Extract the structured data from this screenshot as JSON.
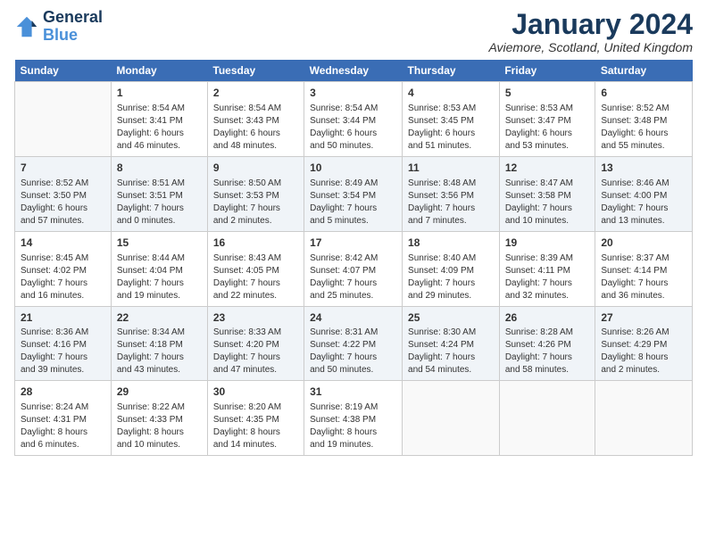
{
  "logo": {
    "line1": "General",
    "line2": "Blue"
  },
  "title": "January 2024",
  "location": "Aviemore, Scotland, United Kingdom",
  "weekdays": [
    "Sunday",
    "Monday",
    "Tuesday",
    "Wednesday",
    "Thursday",
    "Friday",
    "Saturday"
  ],
  "weeks": [
    [
      {
        "day": "",
        "info": ""
      },
      {
        "day": "1",
        "info": "Sunrise: 8:54 AM\nSunset: 3:41 PM\nDaylight: 6 hours\nand 46 minutes."
      },
      {
        "day": "2",
        "info": "Sunrise: 8:54 AM\nSunset: 3:43 PM\nDaylight: 6 hours\nand 48 minutes."
      },
      {
        "day": "3",
        "info": "Sunrise: 8:54 AM\nSunset: 3:44 PM\nDaylight: 6 hours\nand 50 minutes."
      },
      {
        "day": "4",
        "info": "Sunrise: 8:53 AM\nSunset: 3:45 PM\nDaylight: 6 hours\nand 51 minutes."
      },
      {
        "day": "5",
        "info": "Sunrise: 8:53 AM\nSunset: 3:47 PM\nDaylight: 6 hours\nand 53 minutes."
      },
      {
        "day": "6",
        "info": "Sunrise: 8:52 AM\nSunset: 3:48 PM\nDaylight: 6 hours\nand 55 minutes."
      }
    ],
    [
      {
        "day": "7",
        "info": "Sunrise: 8:52 AM\nSunset: 3:50 PM\nDaylight: 6 hours\nand 57 minutes."
      },
      {
        "day": "8",
        "info": "Sunrise: 8:51 AM\nSunset: 3:51 PM\nDaylight: 7 hours\nand 0 minutes."
      },
      {
        "day": "9",
        "info": "Sunrise: 8:50 AM\nSunset: 3:53 PM\nDaylight: 7 hours\nand 2 minutes."
      },
      {
        "day": "10",
        "info": "Sunrise: 8:49 AM\nSunset: 3:54 PM\nDaylight: 7 hours\nand 5 minutes."
      },
      {
        "day": "11",
        "info": "Sunrise: 8:48 AM\nSunset: 3:56 PM\nDaylight: 7 hours\nand 7 minutes."
      },
      {
        "day": "12",
        "info": "Sunrise: 8:47 AM\nSunset: 3:58 PM\nDaylight: 7 hours\nand 10 minutes."
      },
      {
        "day": "13",
        "info": "Sunrise: 8:46 AM\nSunset: 4:00 PM\nDaylight: 7 hours\nand 13 minutes."
      }
    ],
    [
      {
        "day": "14",
        "info": "Sunrise: 8:45 AM\nSunset: 4:02 PM\nDaylight: 7 hours\nand 16 minutes."
      },
      {
        "day": "15",
        "info": "Sunrise: 8:44 AM\nSunset: 4:04 PM\nDaylight: 7 hours\nand 19 minutes."
      },
      {
        "day": "16",
        "info": "Sunrise: 8:43 AM\nSunset: 4:05 PM\nDaylight: 7 hours\nand 22 minutes."
      },
      {
        "day": "17",
        "info": "Sunrise: 8:42 AM\nSunset: 4:07 PM\nDaylight: 7 hours\nand 25 minutes."
      },
      {
        "day": "18",
        "info": "Sunrise: 8:40 AM\nSunset: 4:09 PM\nDaylight: 7 hours\nand 29 minutes."
      },
      {
        "day": "19",
        "info": "Sunrise: 8:39 AM\nSunset: 4:11 PM\nDaylight: 7 hours\nand 32 minutes."
      },
      {
        "day": "20",
        "info": "Sunrise: 8:37 AM\nSunset: 4:14 PM\nDaylight: 7 hours\nand 36 minutes."
      }
    ],
    [
      {
        "day": "21",
        "info": "Sunrise: 8:36 AM\nSunset: 4:16 PM\nDaylight: 7 hours\nand 39 minutes."
      },
      {
        "day": "22",
        "info": "Sunrise: 8:34 AM\nSunset: 4:18 PM\nDaylight: 7 hours\nand 43 minutes."
      },
      {
        "day": "23",
        "info": "Sunrise: 8:33 AM\nSunset: 4:20 PM\nDaylight: 7 hours\nand 47 minutes."
      },
      {
        "day": "24",
        "info": "Sunrise: 8:31 AM\nSunset: 4:22 PM\nDaylight: 7 hours\nand 50 minutes."
      },
      {
        "day": "25",
        "info": "Sunrise: 8:30 AM\nSunset: 4:24 PM\nDaylight: 7 hours\nand 54 minutes."
      },
      {
        "day": "26",
        "info": "Sunrise: 8:28 AM\nSunset: 4:26 PM\nDaylight: 7 hours\nand 58 minutes."
      },
      {
        "day": "27",
        "info": "Sunrise: 8:26 AM\nSunset: 4:29 PM\nDaylight: 8 hours\nand 2 minutes."
      }
    ],
    [
      {
        "day": "28",
        "info": "Sunrise: 8:24 AM\nSunset: 4:31 PM\nDaylight: 8 hours\nand 6 minutes."
      },
      {
        "day": "29",
        "info": "Sunrise: 8:22 AM\nSunset: 4:33 PM\nDaylight: 8 hours\nand 10 minutes."
      },
      {
        "day": "30",
        "info": "Sunrise: 8:20 AM\nSunset: 4:35 PM\nDaylight: 8 hours\nand 14 minutes."
      },
      {
        "day": "31",
        "info": "Sunrise: 8:19 AM\nSunset: 4:38 PM\nDaylight: 8 hours\nand 19 minutes."
      },
      {
        "day": "",
        "info": ""
      },
      {
        "day": "",
        "info": ""
      },
      {
        "day": "",
        "info": ""
      }
    ]
  ]
}
